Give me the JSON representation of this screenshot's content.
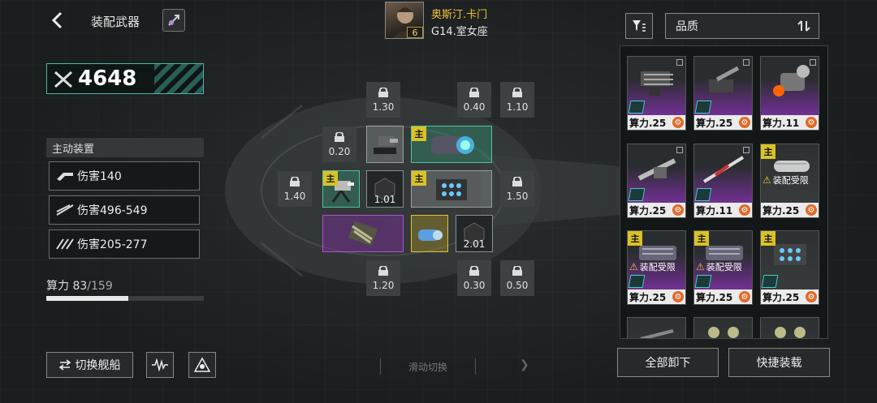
{
  "header": {
    "title": "装配武器",
    "commander_name": "奥斯汀.卡门",
    "commander_level": "6",
    "ship_name": "G14.室女座"
  },
  "power": {
    "value": "4648"
  },
  "active": {
    "heading": "主动装置",
    "stats": [
      "伤害140",
      "伤害496-549",
      "伤害205-277"
    ]
  },
  "calc": {
    "label": "算力",
    "used": "83",
    "total": "/159",
    "progress": 0.52
  },
  "bottom": {
    "switch_ship": "切换舰船",
    "swipe_hint": "滑动切换"
  },
  "slots": {
    "locked": [
      "1.30",
      "0.40",
      "1.10",
      "0.20",
      "1.40",
      "1.50",
      "1.20",
      "0.30",
      "0.50"
    ],
    "values": {
      "dark1": "1.01",
      "dark2": "2.01"
    },
    "main_label": "主"
  },
  "inventory": {
    "sort_label": "品质",
    "cards": [
      {
        "cost": "算力.25",
        "quality": "purple"
      },
      {
        "cost": "算力.25",
        "quality": "purple"
      },
      {
        "cost": "算力.11",
        "quality": "purple"
      },
      {
        "cost": "算力.25",
        "quality": "purple"
      },
      {
        "cost": "算力.11",
        "quality": "purple"
      },
      {
        "cost": "算力.25",
        "quality": "gray",
        "main": "主",
        "warn": "装配受限"
      },
      {
        "cost": "算力.25",
        "quality": "purple",
        "main": "主",
        "warn": "装配受限"
      },
      {
        "cost": "算力.25",
        "quality": "purple",
        "main": "主",
        "warn": "装配受限"
      },
      {
        "cost": "算力.25",
        "quality": "gray",
        "main": "主"
      }
    ],
    "unload_all": "全部卸下",
    "quick_equip": "快捷装载"
  },
  "colors": {
    "accent": "#4fb7a8",
    "gold": "#f0c23b",
    "purple": "#8a3fb0",
    "green": "#4fc49c"
  }
}
